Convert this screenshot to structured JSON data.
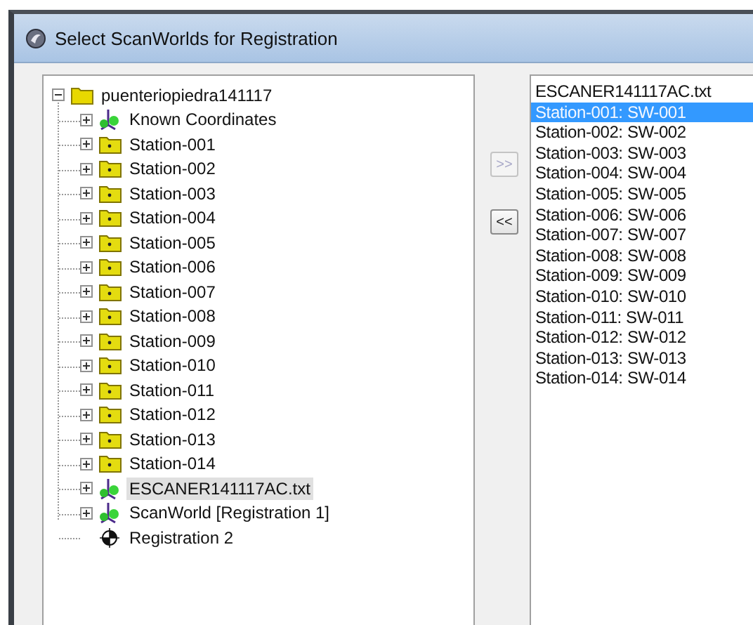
{
  "window": {
    "title": "Select ScanWorlds for Registration"
  },
  "tree": {
    "label": "puenteriopiedra141117",
    "kind": "project",
    "expandable": true,
    "expanded": true,
    "selected": false,
    "children": [
      {
        "label": "Known Coordinates",
        "kind": "coordinates",
        "expandable": true,
        "selected": false
      },
      {
        "label": "Station-001",
        "kind": "station",
        "expandable": true,
        "selected": false
      },
      {
        "label": "Station-002",
        "kind": "station",
        "expandable": true,
        "selected": false
      },
      {
        "label": "Station-003",
        "kind": "station",
        "expandable": true,
        "selected": false
      },
      {
        "label": "Station-004",
        "kind": "station",
        "expandable": true,
        "selected": false
      },
      {
        "label": "Station-005",
        "kind": "station",
        "expandable": true,
        "selected": false
      },
      {
        "label": "Station-006",
        "kind": "station",
        "expandable": true,
        "selected": false
      },
      {
        "label": "Station-007",
        "kind": "station",
        "expandable": true,
        "selected": false
      },
      {
        "label": "Station-008",
        "kind": "station",
        "expandable": true,
        "selected": false
      },
      {
        "label": "Station-009",
        "kind": "station",
        "expandable": true,
        "selected": false
      },
      {
        "label": "Station-010",
        "kind": "station",
        "expandable": true,
        "selected": false
      },
      {
        "label": "Station-011",
        "kind": "station",
        "expandable": true,
        "selected": false
      },
      {
        "label": "Station-012",
        "kind": "station",
        "expandable": true,
        "selected": false
      },
      {
        "label": "Station-013",
        "kind": "station",
        "expandable": true,
        "selected": false
      },
      {
        "label": "Station-014",
        "kind": "station",
        "expandable": true,
        "selected": false
      },
      {
        "label": "ESCANER141117AC.txt",
        "kind": "coordinates",
        "expandable": true,
        "selected": true
      },
      {
        "label": "ScanWorld [Registration 1]",
        "kind": "coordinates",
        "expandable": true,
        "selected": false
      },
      {
        "label": "Registration 2",
        "kind": "registration",
        "expandable": false,
        "selected": false
      }
    ]
  },
  "move_buttons": [
    {
      "label": ">>",
      "disabled": true
    },
    {
      "label": "<<",
      "disabled": false
    }
  ],
  "selected_list": [
    {
      "label": "ESCANER141117AC.txt",
      "selected": false
    },
    {
      "label": "Station-001: SW-001",
      "selected": true
    },
    {
      "label": "Station-002: SW-002",
      "selected": false
    },
    {
      "label": "Station-003: SW-003",
      "selected": false
    },
    {
      "label": "Station-004: SW-004",
      "selected": false
    },
    {
      "label": "Station-005: SW-005",
      "selected": false
    },
    {
      "label": "Station-006: SW-006",
      "selected": false
    },
    {
      "label": "Station-007: SW-007",
      "selected": false
    },
    {
      "label": "Station-008: SW-008",
      "selected": false
    },
    {
      "label": "Station-009: SW-009",
      "selected": false
    },
    {
      "label": "Station-010: SW-010",
      "selected": false
    },
    {
      "label": "Station-011: SW-011",
      "selected": false
    },
    {
      "label": "Station-012: SW-012",
      "selected": false
    },
    {
      "label": "Station-013: SW-013",
      "selected": false
    },
    {
      "label": "Station-014: SW-014",
      "selected": false
    }
  ]
}
